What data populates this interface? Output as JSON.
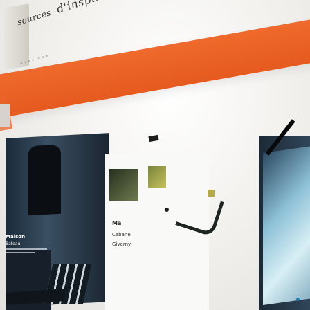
{
  "photo": {
    "logo": {
      "sources": "sources",
      "inspiration": "d'inspiration"
    },
    "tagline": "•••• •••"
  },
  "colors": {
    "accent_orange": "#e55a1f",
    "background": "#f4f3f1",
    "dark_navy": "#1b2530"
  },
  "cards": {
    "left_text": {
      "line1": "Maison",
      "line2": "Bateau"
    },
    "mid_text": {
      "line1": "Ma",
      "line2": "Cabane",
      "line3": "Giverny"
    }
  }
}
